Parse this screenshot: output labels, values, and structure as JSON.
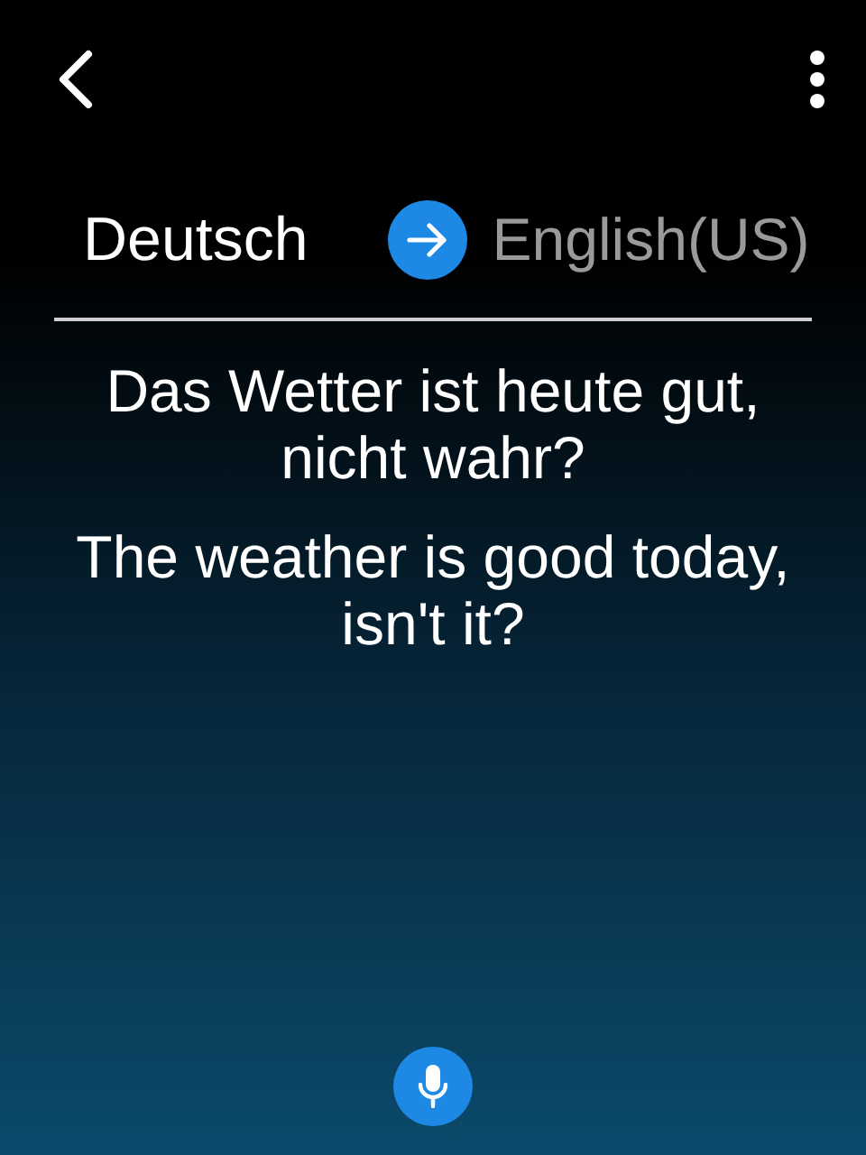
{
  "source_language": "Deutsch",
  "target_language": "English(US)",
  "source_text": "Das Wetter ist heute gut, nicht wahr?",
  "translated_text": "The weather is good today, isn't it?"
}
